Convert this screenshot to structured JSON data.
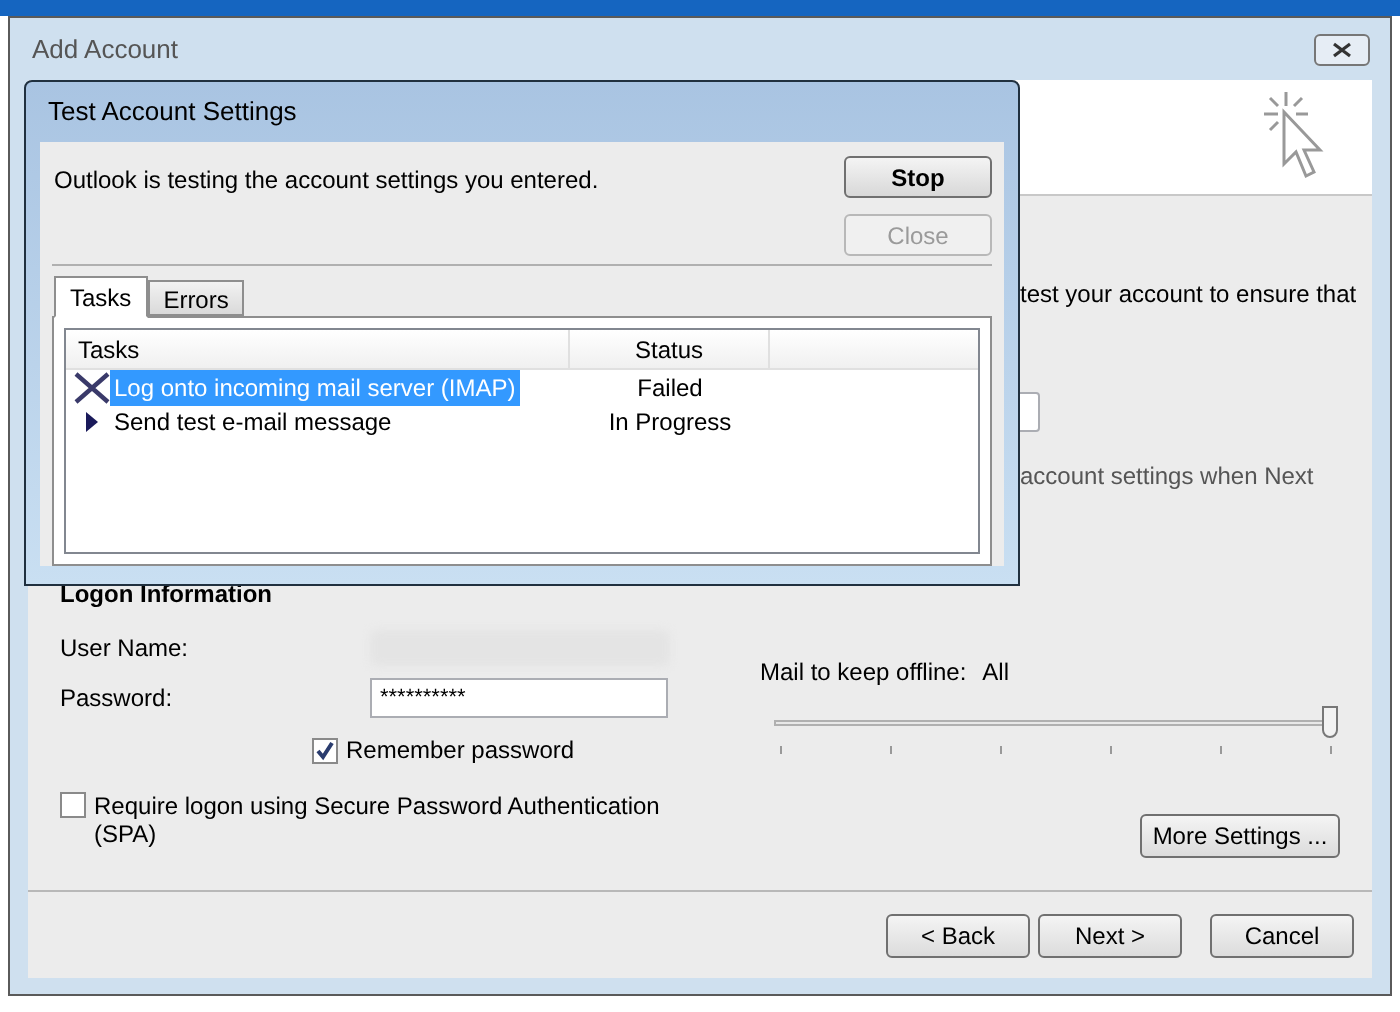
{
  "window": {
    "title": "Add Account"
  },
  "background": {
    "texts": [
      "test your account to ensure that",
      "account settings when Next"
    ],
    "logon_heading": "Logon Information",
    "user_name_label": "User Name:",
    "password_label": "Password:",
    "password_value": "**********",
    "remember_password": {
      "label": "Remember password",
      "checked": true
    },
    "spa": {
      "label": "Require logon using Secure Password Authentication (SPA)",
      "checked": false
    },
    "offline_label": "Mail to keep offline:",
    "offline_value": "All",
    "offline_slider": {
      "level": 1
    },
    "more_settings": "More Settings ...",
    "buttons": [
      "< Back",
      "Next >",
      "Cancel"
    ]
  },
  "dialog": {
    "title": "Test Account Settings",
    "message": "Outlook is testing the account settings you entered.",
    "buttons": [
      {
        "label": "Stop",
        "disabled": false
      },
      {
        "label": "Close",
        "disabled": true
      }
    ],
    "tabs": [
      {
        "label": "Tasks",
        "selected": true
      },
      {
        "label": "Errors",
        "selected": false
      }
    ],
    "columns": [
      "Tasks",
      "Status"
    ],
    "rows": [
      {
        "task": "Log onto incoming mail server (IMAP)",
        "status": "Failed",
        "kind": "failed",
        "selected": true
      },
      {
        "task": "Send test e-mail message",
        "status": "In Progress",
        "kind": "progress",
        "selected": false
      }
    ]
  }
}
